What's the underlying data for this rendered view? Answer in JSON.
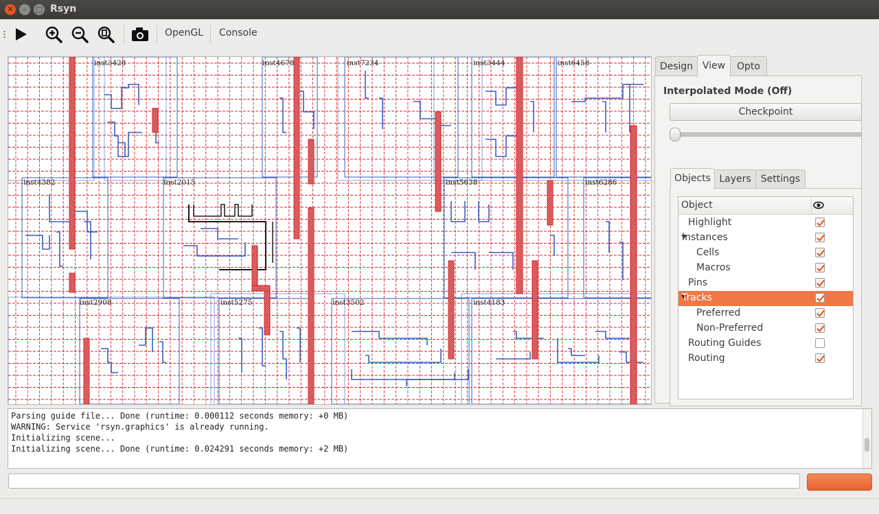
{
  "window": {
    "title": "Rsyn"
  },
  "toolbar": {
    "icons": [
      "play-icon",
      "zoom-in-icon",
      "zoom-out-icon",
      "zoom-fit-icon",
      "camera-icon"
    ],
    "opengl_label": "OpenGL",
    "console_label": "Console"
  },
  "canvas": {
    "instances": [
      "inst3428",
      "inst4678",
      "inst7234",
      "inst3444",
      "inst6458",
      "inst4382",
      "inst2015",
      "inst5638",
      "inst6286",
      "inst2908",
      "inst5275",
      "inst3502",
      "inst4183"
    ],
    "colors": {
      "grid": "#d9262c",
      "cell": "#3a5fbf",
      "wire": "#d42a2a",
      "macro": "#1a1a1a"
    }
  },
  "panel": {
    "tabs": [
      "Design",
      "View",
      "Opto"
    ],
    "active_tab": "View",
    "interp_mode": "Interpolated Mode (Off)",
    "checkpoint_label": "Checkpoint",
    "slider_position": 0,
    "inner_tabs": [
      "Objects",
      "Layers",
      "Settings"
    ],
    "active_inner_tab": "Objects",
    "tree": {
      "header": "Object",
      "header_icon": "eye-icon",
      "rows": [
        {
          "label": "Highlight",
          "checked": true
        },
        {
          "label": "Instances",
          "checked": true,
          "expanded": true
        },
        {
          "label": "Cells",
          "checked": true
        },
        {
          "label": "Macros",
          "checked": true
        },
        {
          "label": "Pins",
          "checked": true
        },
        {
          "label": "Tracks",
          "checked": true,
          "expanded": true,
          "selected": true
        },
        {
          "label": "Preferred",
          "checked": true
        },
        {
          "label": "Non-Preferred",
          "checked": true
        },
        {
          "label": "Routing Guides",
          "checked": false
        },
        {
          "label": "Routing",
          "checked": true
        }
      ]
    }
  },
  "console": {
    "lines": [
      "Parsing guide file... Done (runtime: 0.000112 seconds memory: +0 MB)",
      "WARNING: Service 'rsyn.graphics' is already running.",
      "Initializing scene...",
      "Initializing scene... Done (runtime: 0.024291 seconds memory: +2 MB)"
    ],
    "command_value": "",
    "accent": "#e95420"
  }
}
